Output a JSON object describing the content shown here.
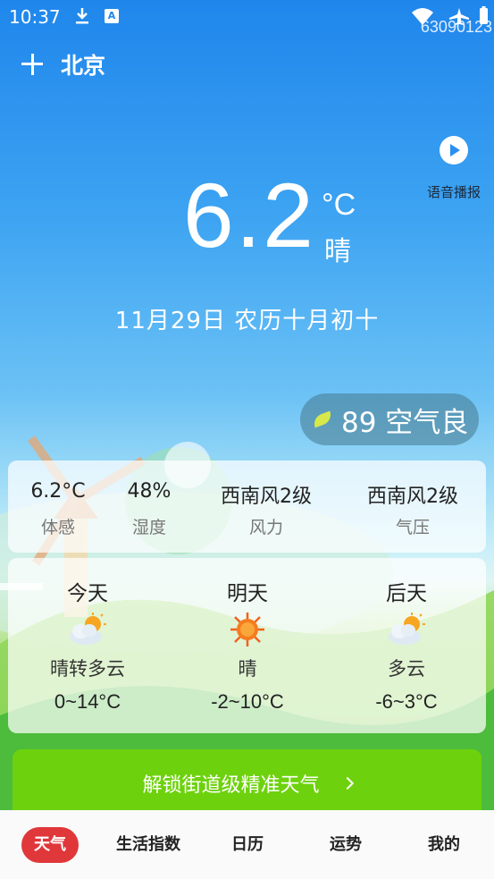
{
  "status_bar": {
    "time": "10:37",
    "device_id": "63090123"
  },
  "header": {
    "city": "北京"
  },
  "voice": {
    "label": "语音播报"
  },
  "current": {
    "temp": "6.2",
    "unit": "°C",
    "condition": "晴"
  },
  "date_line": "11月29日 农历十月初十",
  "aqi": {
    "text": "89 空气良"
  },
  "stats": [
    {
      "value": "6.2°C",
      "label": "体感"
    },
    {
      "value": "48%",
      "label": "湿度"
    },
    {
      "value": "西南风2级",
      "label": "风力"
    },
    {
      "value": "西南风2级",
      "label": "气压"
    }
  ],
  "forecast": [
    {
      "day": "今天",
      "icon": "partly-cloudy-icon",
      "condition": "晴转多云",
      "temp": "0~14°C"
    },
    {
      "day": "明天",
      "icon": "sunny-icon",
      "condition": "晴",
      "temp": "-2~10°C"
    },
    {
      "day": "后天",
      "icon": "partly-cloudy-icon",
      "condition": "多云",
      "temp": "-6~3°C"
    }
  ],
  "unlock_banner": {
    "text": "解锁街道级精准天气"
  },
  "tabs": [
    {
      "label": "天气",
      "active": true
    },
    {
      "label": "生活指数",
      "active": false
    },
    {
      "label": "日历",
      "active": false
    },
    {
      "label": "运势",
      "active": false
    },
    {
      "label": "我的",
      "active": false
    }
  ],
  "colors": {
    "accent": "#e0373a",
    "banner": "#6dd20d",
    "sky_top": "#1f86ec"
  }
}
